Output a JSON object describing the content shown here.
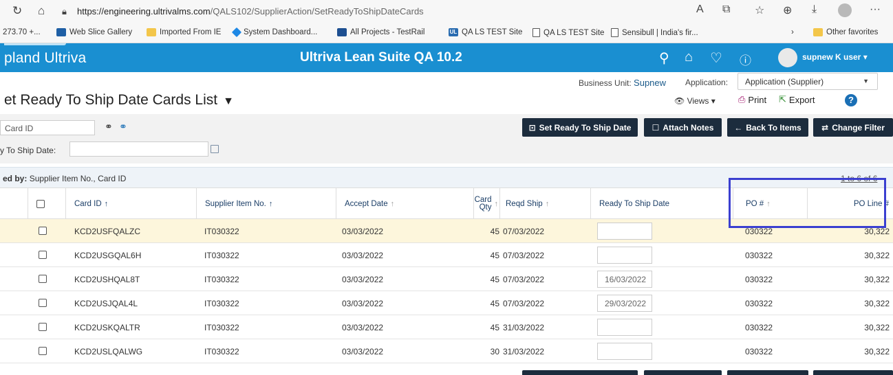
{
  "browser": {
    "url_host": "https://engineering.ultrivalms.com",
    "url_path": "/QALS102/SupplierAction/SetReadyToShipDateCards",
    "favorites": [
      {
        "label": "273.70 +...",
        "icon": "none"
      },
      {
        "label": "Web Slice Gallery",
        "icon": "ws"
      },
      {
        "label": "Imported From IE",
        "icon": "folder"
      },
      {
        "label": "System Dashboard...",
        "icon": "diam"
      },
      {
        "label": "All Projects - TestRail",
        "icon": "bars"
      },
      {
        "label": "QA LS TEST Site",
        "icon": "ul"
      },
      {
        "label": "QA LS TEST Site",
        "icon": "page"
      },
      {
        "label": "Sensibull | India's fir...",
        "icon": "page"
      }
    ],
    "other_favorites": "Other favorites"
  },
  "app": {
    "brand": "pland Ultriva",
    "title": "Ultriva Lean Suite QA 10.2",
    "user": "supnew K user"
  },
  "page": {
    "business_unit_label": "Business Unit:",
    "business_unit": "Supnew",
    "application_label": "Application:",
    "application_value": "Application (Supplier)",
    "title": "et Ready To Ship Date Cards List",
    "views": "Views",
    "print": "Print",
    "export": "Export"
  },
  "filter": {
    "card_id_placeholder": "Card ID",
    "ship_date_label": "y To Ship Date:",
    "buttons": {
      "set_ready": "Set Ready To Ship Date",
      "attach_notes": "Attach Notes",
      "back_to_items": "Back To Items",
      "change_filter": "Change Filter"
    }
  },
  "sort": {
    "label": "ed by:",
    "value": "Supplier Item No., Card ID",
    "pager": "1 to 6 of 6"
  },
  "columns": {
    "card_id": "Card ID",
    "supplier_item": "Supplier Item No.",
    "accept_date": "Accept Date",
    "card_qty_1": "Card",
    "card_qty_2": "Qty",
    "reqd_ship": "Reqd Ship",
    "rts_date": "Ready To Ship Date",
    "po": "PO #",
    "po_line": "PO Line #"
  },
  "rows": [
    {
      "card_id": "KCD2USFQALZC",
      "item": "IT030322",
      "accept": "03/03/2022",
      "qty": "45",
      "reqd": "07/03/2022",
      "rts": "",
      "po": "030322",
      "line": "30,322"
    },
    {
      "card_id": "KCD2USGQAL6H",
      "item": "IT030322",
      "accept": "03/03/2022",
      "qty": "45",
      "reqd": "07/03/2022",
      "rts": "",
      "po": "030322",
      "line": "30,322"
    },
    {
      "card_id": "KCD2USHQAL8T",
      "item": "IT030322",
      "accept": "03/03/2022",
      "qty": "45",
      "reqd": "07/03/2022",
      "rts": "16/03/2022",
      "po": "030322",
      "line": "30,322"
    },
    {
      "card_id": "KCD2USJQAL4L",
      "item": "IT030322",
      "accept": "03/03/2022",
      "qty": "45",
      "reqd": "07/03/2022",
      "rts": "29/03/2022",
      "po": "030322",
      "line": "30,322"
    },
    {
      "card_id": "KCD2USKQALTR",
      "item": "IT030322",
      "accept": "03/03/2022",
      "qty": "45",
      "reqd": "31/03/2022",
      "rts": "",
      "po": "030322",
      "line": "30,322"
    },
    {
      "card_id": "KCD2USLQALWG",
      "item": "IT030322",
      "accept": "03/03/2022",
      "qty": "30",
      "reqd": "31/03/2022",
      "rts": "",
      "po": "030322",
      "line": "30,322"
    }
  ]
}
